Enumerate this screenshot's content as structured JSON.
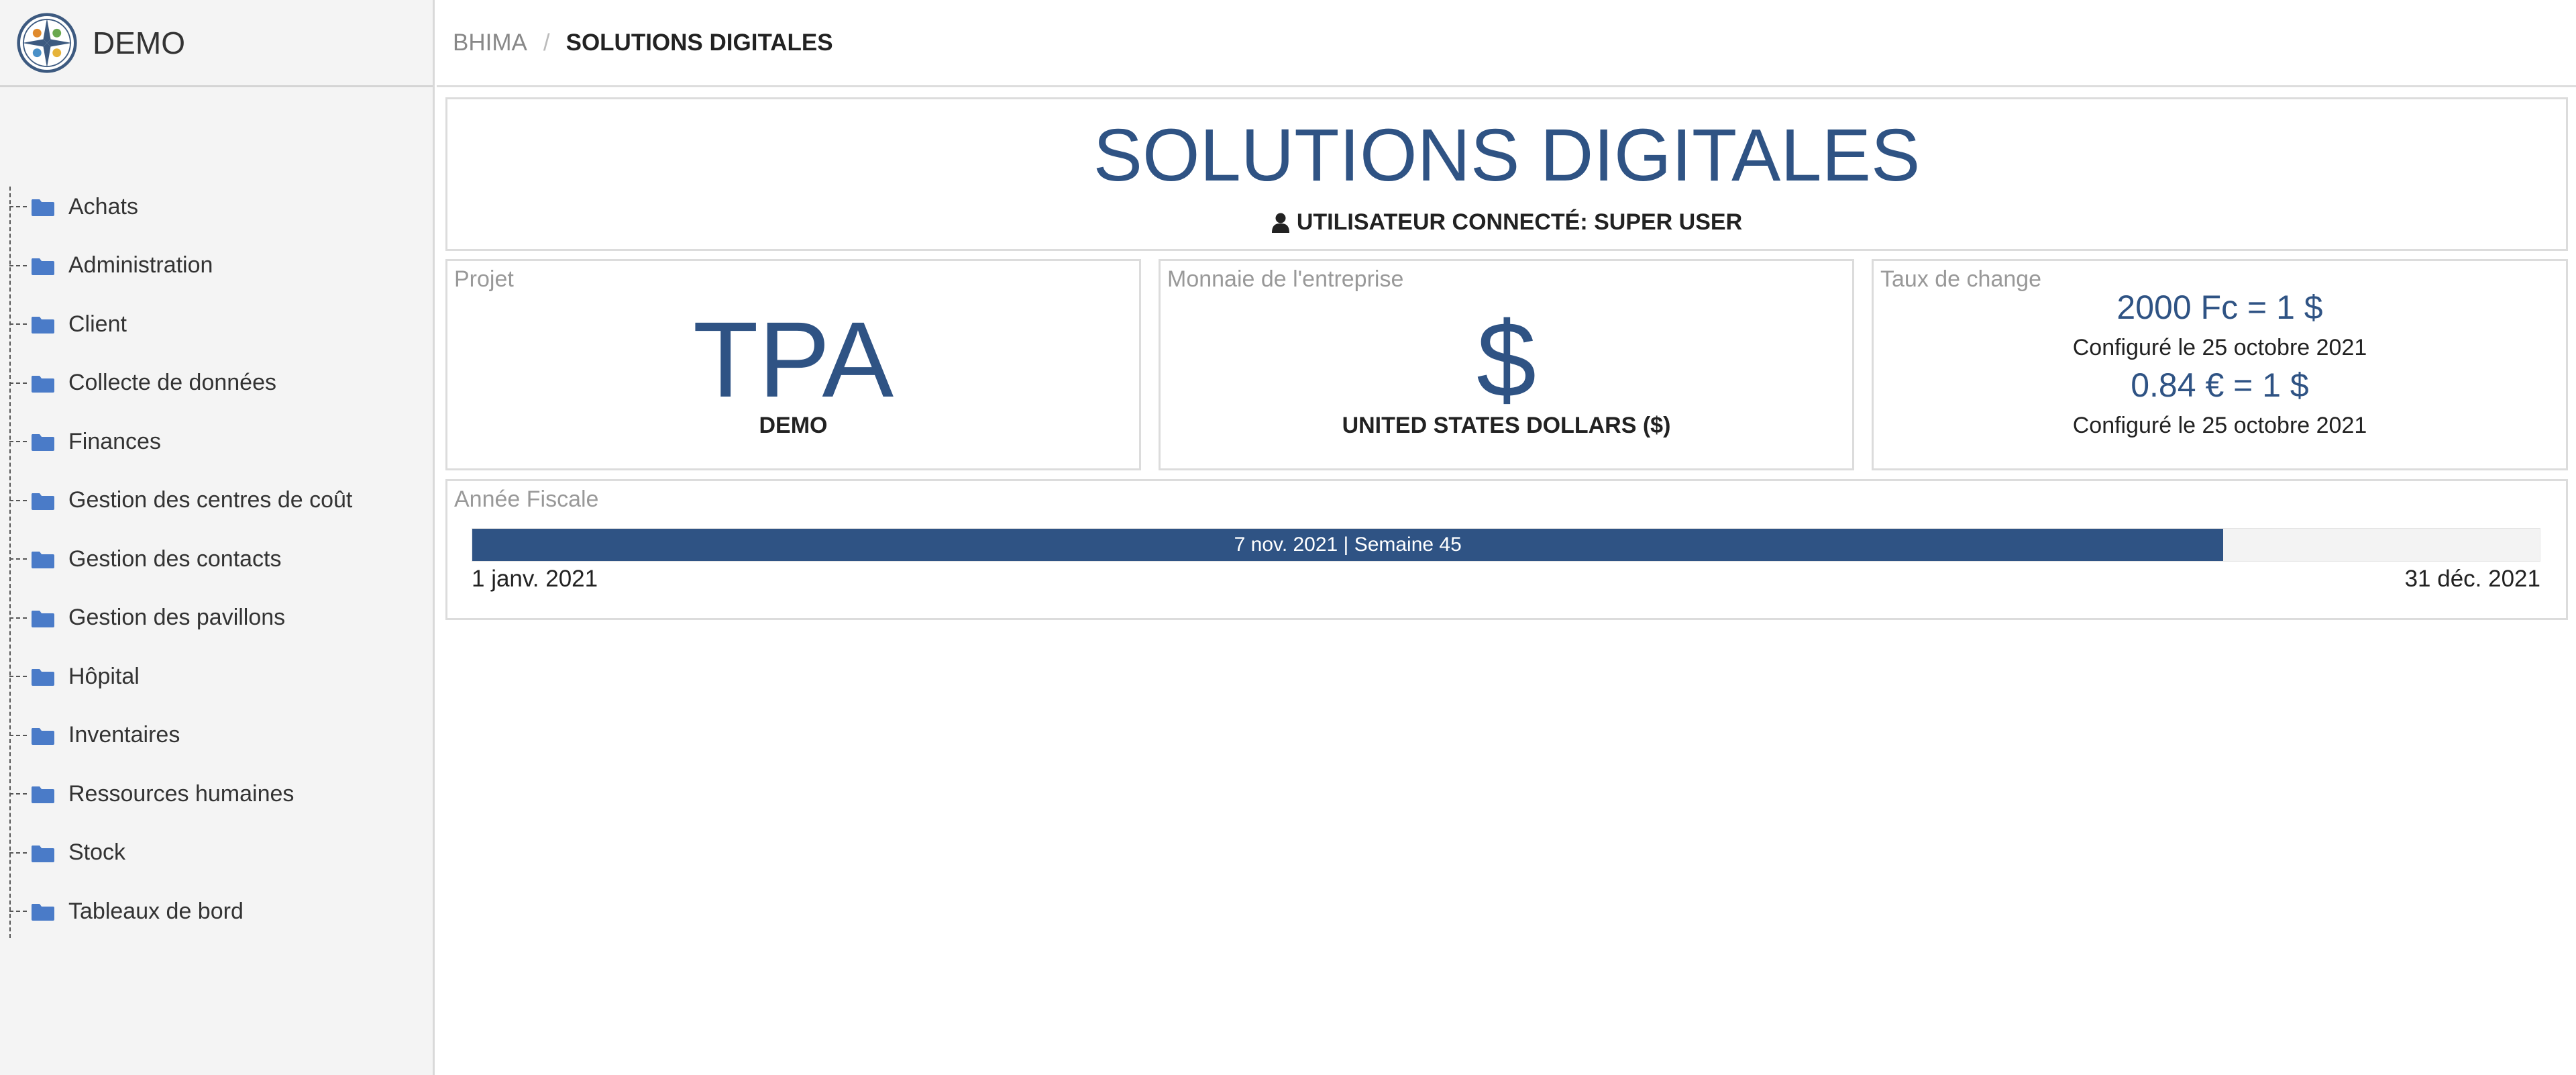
{
  "app": {
    "name": "DEMO",
    "logo_icon": "compass-logo-icon"
  },
  "sidebar": {
    "folder_icon": "folder-icon",
    "folder_color": "#4a7bc8",
    "items": [
      {
        "label": "Achats"
      },
      {
        "label": "Administration"
      },
      {
        "label": "Client"
      },
      {
        "label": "Collecte de données"
      },
      {
        "label": "Finances"
      },
      {
        "label": "Gestion des centres de coût"
      },
      {
        "label": "Gestion des contacts"
      },
      {
        "label": "Gestion des pavillons"
      },
      {
        "label": "Hôpital"
      },
      {
        "label": "Inventaires"
      },
      {
        "label": "Ressources humaines"
      },
      {
        "label": "Stock"
      },
      {
        "label": "Tableaux de bord"
      }
    ]
  },
  "breadcrumb": {
    "root": "BHIMA",
    "separator": "/",
    "current": "SOLUTIONS DIGITALES"
  },
  "hero": {
    "title": "SOLUTIONS DIGITALES",
    "user_icon": "user-icon",
    "user_text": "UTILISATEUR CONNECTÉ: SUPER USER"
  },
  "project": {
    "label": "Projet",
    "value": "TPA",
    "name": "DEMO"
  },
  "currency": {
    "label": "Monnaie de l'entreprise",
    "symbol": "$",
    "name": "UNITED STATES DOLLARS ($)"
  },
  "exchange": {
    "label": "Taux de change",
    "rates": [
      {
        "rate": "2000 Fc = 1 $",
        "configured": "Configuré le 25 octobre 2021"
      },
      {
        "rate": "0.84 € = 1 $",
        "configured": "Configuré le 25 octobre 2021"
      }
    ]
  },
  "fiscal_year": {
    "label": "Année Fiscale",
    "progress_text": "7 nov. 2021 | Semaine 45",
    "progress_fraction": 0.847,
    "start": "1 janv. 2021",
    "end": "31 déc. 2021"
  },
  "colors": {
    "accent": "#2f5384",
    "folder": "#4a7bc8",
    "sidebar_bg": "#f4f4f4"
  }
}
